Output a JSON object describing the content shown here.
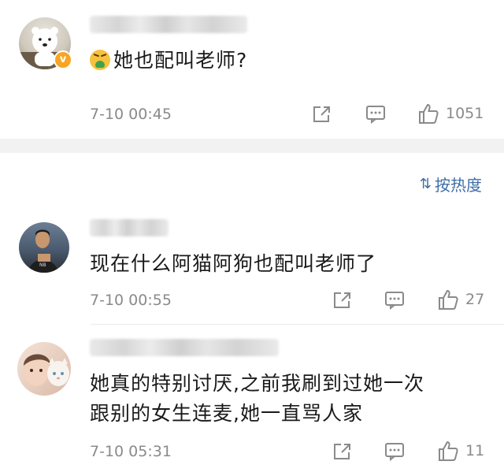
{
  "top_comment": {
    "avatar_icon": "polar-bear-avatar-icon",
    "verified_icon": "verified-badge-icon",
    "verified_glyph": "v",
    "emoji_icon": "nauseated-face-emoji-icon",
    "text": "她也配叫老师?",
    "time": "7-10 00:45",
    "likes": "1051"
  },
  "sort": {
    "icon": "sort-icon",
    "icon_glyph": "⇅",
    "label": "按热度"
  },
  "replies": [
    {
      "avatar_icon": "basketball-player-avatar-icon",
      "text": "现在什么阿猫阿狗也配叫老师了",
      "time": "7-10 00:55",
      "likes": "27"
    },
    {
      "avatar_icon": "person-with-cat-avatar-icon",
      "text_line1": "她真的特别讨厌,之前我刷到过她一次",
      "text_line2": "跟别的女生连麦,她一直骂人家",
      "time": "7-10 05:31",
      "likes": "11"
    }
  ],
  "colors": {
    "accent_link": "#3f6ea8",
    "meta_gray": "#8a8a8a",
    "band_gray": "#f2f2f2",
    "verified_orange": "#f6a623"
  }
}
